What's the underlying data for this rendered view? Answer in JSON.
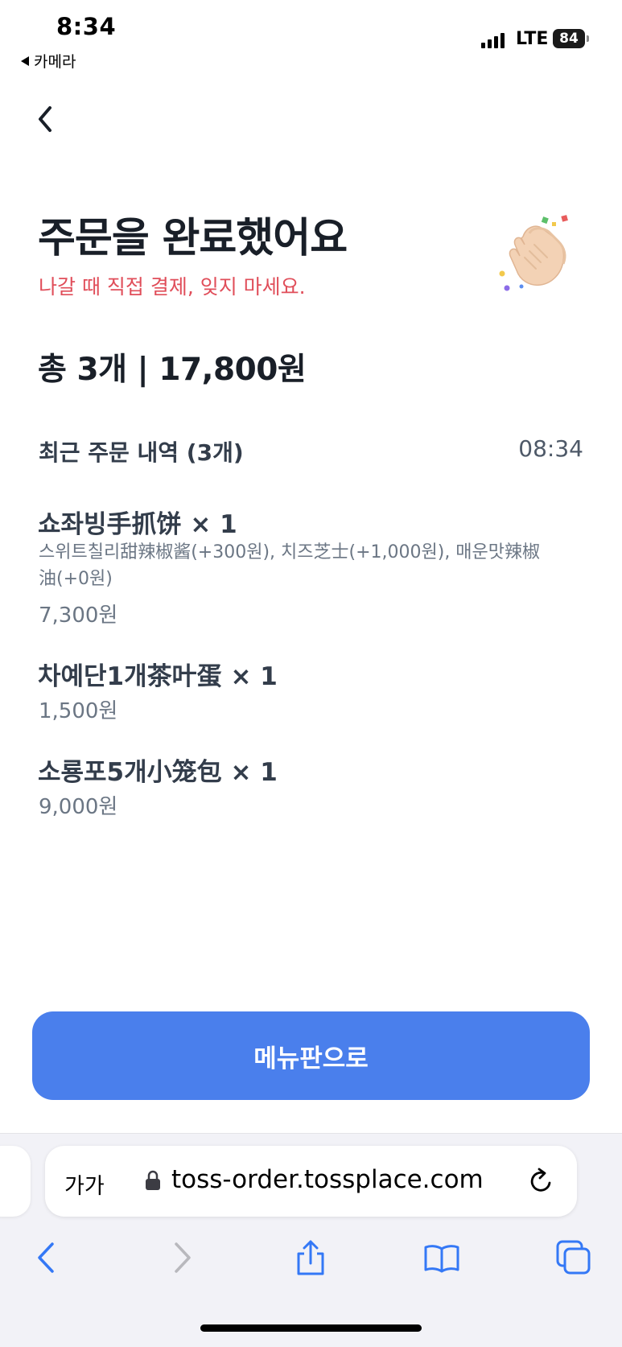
{
  "status_bar": {
    "time": "8:34",
    "back_app": "카메라",
    "network": "LTE",
    "battery": "84"
  },
  "header": {
    "title": "주문을 완료했어요",
    "subtitle": "나갈 때 직접 결제, 잊지 마세요."
  },
  "summary": {
    "total": "총 3개 | 17,800원"
  },
  "recent_orders": {
    "label": "최근 주문 내역 (3개)",
    "time": "08:34",
    "items": [
      {
        "name": "쇼좌빙手抓饼 × 1",
        "options": "스위트칠리甜辣椒酱(+300원), 치즈芝士(+1,000원), 매운맛辣椒油(+0원)",
        "price": "7,300원"
      },
      {
        "name": "차예단1개茶叶蛋 × 1",
        "price": "1,500원"
      },
      {
        "name": "소룡포5개小笼包 × 1",
        "price": "9,000원"
      }
    ]
  },
  "cta": {
    "label": "메뉴판으로"
  },
  "browser": {
    "text_size_label": "가가",
    "url": "toss-order.tossplace.com"
  },
  "colors": {
    "accent": "#4a7fec",
    "warning_text": "#e04e5a",
    "title_text": "#191f28",
    "secondary_text": "#6b7684"
  },
  "icons": {
    "nav_back": "chevron-left-icon",
    "celebration": "clapping-hand-icon",
    "lock": "lock-icon",
    "reload": "reload-icon",
    "toolbar": [
      "back-arrow-icon",
      "forward-arrow-icon",
      "share-icon",
      "bookmarks-icon",
      "tabs-icon"
    ]
  }
}
